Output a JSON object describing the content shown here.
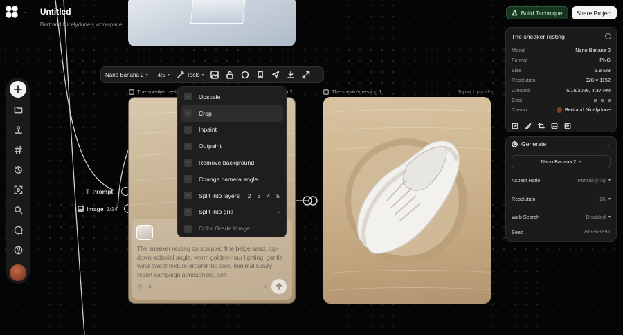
{
  "project": {
    "title": "Untitled",
    "workspace": "Bertrand Nicelydone's workspace"
  },
  "header": {
    "build_label": "Build Technique",
    "share_label": "Share Project"
  },
  "sidebar": {
    "items": [
      "add-icon",
      "folder-icon",
      "upload-icon",
      "hash-icon",
      "history-icon",
      "scan-icon",
      "search-icon",
      "chat-icon",
      "help-icon",
      "avatar"
    ]
  },
  "node": {
    "prompt_label": "Prompt",
    "image_label": "Image",
    "image_count": "1/14"
  },
  "toolbar": {
    "model": "Nano Banana 2",
    "ratio": "4:5",
    "tools": "Tools"
  },
  "captions": {
    "left": "The sneaker resting",
    "left_suffix": "na 2",
    "right": "The sneaker resting 1",
    "right_tag": "Topaz Upscaler"
  },
  "tools_menu": {
    "items": [
      {
        "label": "Upscale",
        "icon": "upscale-icon"
      },
      {
        "label": "Crop",
        "icon": "crop-icon",
        "active": true
      },
      {
        "label": "Inpaint",
        "icon": "inpaint-icon"
      },
      {
        "label": "Outpaint",
        "icon": "outpaint-icon"
      },
      {
        "label": "Remove background",
        "icon": "remove-bg-icon"
      },
      {
        "label": "Change camera angle",
        "icon": "camera-icon"
      },
      {
        "label": "Split into layers",
        "icon": "layers-icon"
      },
      {
        "label": "Split into grid",
        "icon": "grid-icon"
      },
      {
        "label": "Color Grade Image",
        "icon": "color-grade-icon"
      }
    ],
    "layer_counts": [
      "2",
      "3",
      "4",
      "5"
    ]
  },
  "prompt": {
    "text": "The sneaker resting on sculpted fine beige sand, top-down editorial angle, warm golden-hour lighting, gentle wind-swept texture around the sole, minimal luxury resort campaign atmosphere, soft"
  },
  "info": {
    "title": "The sneaker resting",
    "rows": [
      {
        "k": "Model",
        "v": "Nano Banana 2"
      },
      {
        "k": "Format",
        "v": "PNG"
      },
      {
        "k": "Size",
        "v": "1.8 MB"
      },
      {
        "k": "Resolution",
        "v": "928 × 1152"
      },
      {
        "k": "Created",
        "v": "5/16/2026, 4:37 PM"
      },
      {
        "k": "Cost",
        "v": ""
      },
      {
        "k": "Creator",
        "v": "Bertrand Nicelydone"
      }
    ]
  },
  "generate": {
    "title": "Generate",
    "model": "Nano Banana 2",
    "aspect_label": "Aspect Ratio",
    "aspect_value": "Portrait (4:5)",
    "resolution_label": "Resolution",
    "resolution_value": "1K",
    "web_label": "Web Search",
    "web_value": "Disabled",
    "seed_label": "Seed",
    "seed_value": "205368891"
  }
}
